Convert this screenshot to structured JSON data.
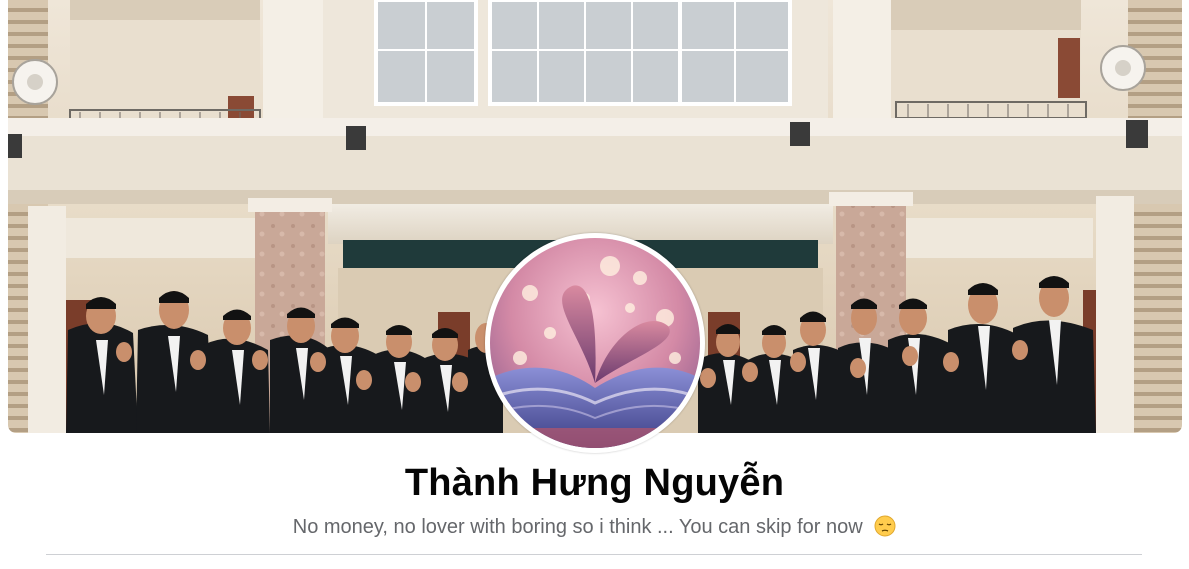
{
  "profile": {
    "name": "Thành Hưng Nguyễn",
    "bio": "No money, no lover with boring so i think ... You can skip for now",
    "bio_emoji": "pensive-face-icon"
  },
  "colors": {
    "name_text": "#050505",
    "bio_text": "#65676b",
    "divider": "#ced0d4"
  }
}
